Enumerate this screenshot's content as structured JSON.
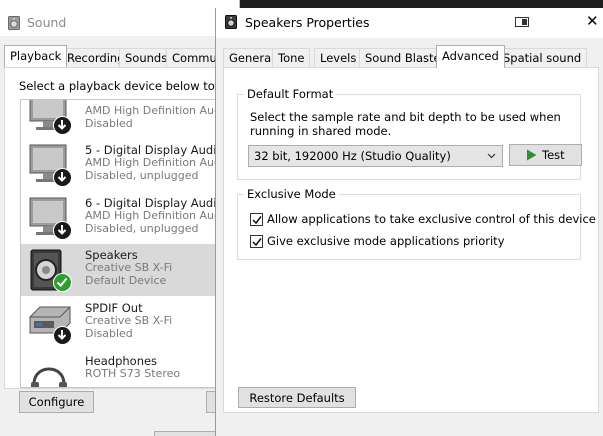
{
  "sound_window": {
    "title": "Sound",
    "tabs": [
      {
        "label": "Playback",
        "active": true
      },
      {
        "label": "Recording",
        "active": false
      },
      {
        "label": "Sounds",
        "active": false
      },
      {
        "label": "Commun",
        "active": false
      }
    ],
    "instruction": "Select a playback device below to mod",
    "devices": [
      {
        "name": "",
        "sub": "AMD High Definition Aud",
        "status": "Disabled",
        "icon": "monitor-icon",
        "badge": "disabled-arrow-icon"
      },
      {
        "name": "5 - Digital Display Audio",
        "sub": "AMD High Definition Aud",
        "status": "Disabled, unplugged",
        "icon": "monitor-icon",
        "badge": "disabled-arrow-icon"
      },
      {
        "name": "6 - Digital Display Audio",
        "sub": "AMD High Definition Aud",
        "status": "Disabled, unplugged",
        "icon": "monitor-icon",
        "badge": "disabled-arrow-icon"
      },
      {
        "name": "Speakers",
        "sub": "Creative SB X-Fi",
        "status": "Default Device",
        "icon": "speaker-icon",
        "badge": "default-check-icon",
        "selected": true
      },
      {
        "name": "SPDIF Out",
        "sub": "Creative SB X-Fi",
        "status": "Disabled",
        "icon": "spdif-device-icon",
        "badge": "disabled-arrow-icon"
      },
      {
        "name": "Headphones",
        "sub": "ROTH S73 Stereo",
        "status": "",
        "icon": "headphones-icon"
      }
    ],
    "configure_label": "Configure"
  },
  "properties_dialog": {
    "title": "Speakers Properties",
    "tabs": [
      {
        "label": "General",
        "active": false
      },
      {
        "label": "Tone",
        "active": false
      },
      {
        "label": "Levels",
        "active": false
      },
      {
        "label": "Sound Blaster",
        "active": false
      },
      {
        "label": "Advanced",
        "active": true
      },
      {
        "label": "Spatial sound",
        "active": false
      }
    ],
    "default_format": {
      "group_label": "Default Format",
      "description": "Select the sample rate and bit depth to be used when running in shared mode.",
      "selected_format": "32 bit, 192000 Hz (Studio Quality)",
      "test_label": "Test"
    },
    "exclusive_mode": {
      "group_label": "Exclusive Mode",
      "options": [
        {
          "label": "Allow applications to take exclusive control of this device",
          "checked": true
        },
        {
          "label": "Give exclusive mode applications priority",
          "checked": true
        }
      ]
    },
    "restore_label": "Restore Defaults"
  },
  "colors": {
    "selected_row": "#d9d9d9",
    "default_badge": "#2e9e2e",
    "play_green": "#2f8f2f"
  }
}
